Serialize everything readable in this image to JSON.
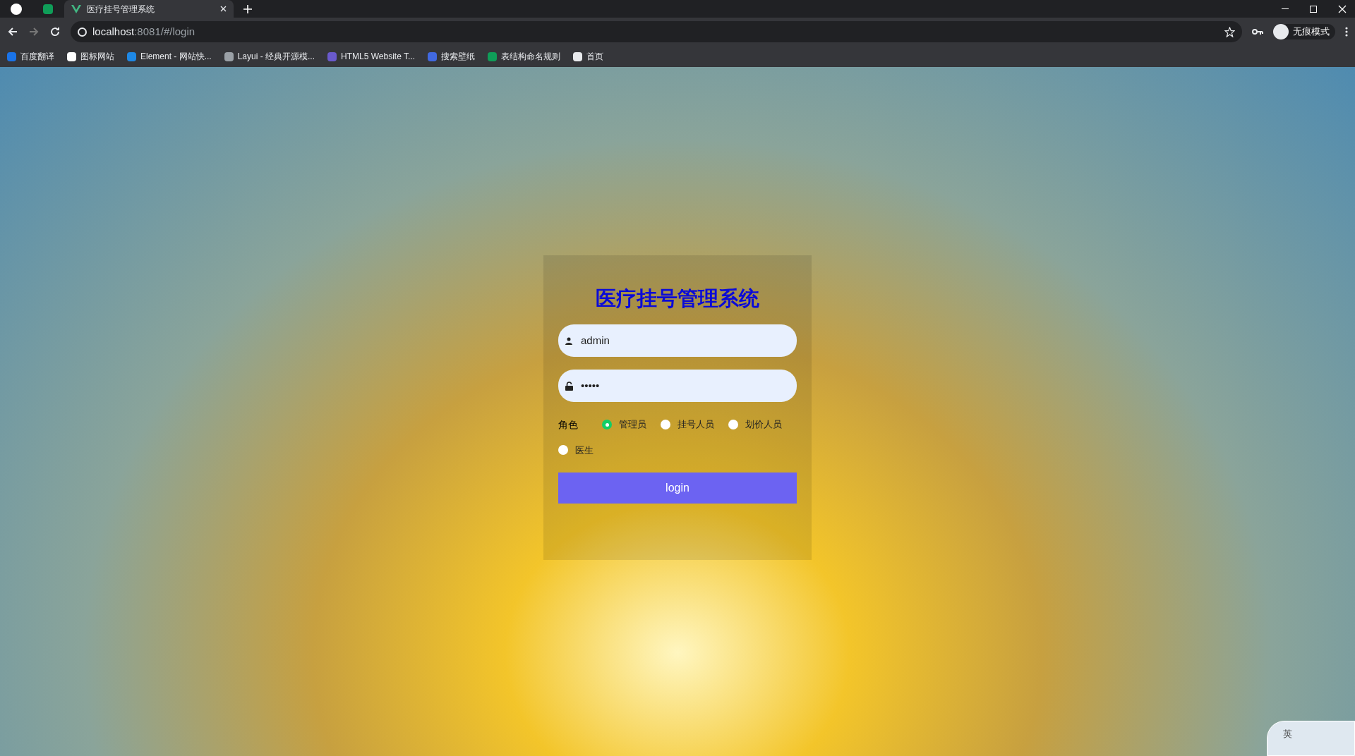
{
  "browser": {
    "tabs": [
      {
        "title": "医疗挂号管理系统",
        "selected": true
      }
    ],
    "address": {
      "host": "localhost",
      "path": ":8081/#/login"
    },
    "profile_label": "无痕模式",
    "bookmarks": [
      {
        "label": "百度翻译"
      },
      {
        "label": "图标网站"
      },
      {
        "label": "Element - 网站快..."
      },
      {
        "label": "Layui - 经典开源模..."
      },
      {
        "label": "HTML5 Website T..."
      },
      {
        "label": "搜索壁纸"
      },
      {
        "label": "表结构命名规则"
      },
      {
        "label": "首页"
      }
    ]
  },
  "login": {
    "title": "医疗挂号管理系统",
    "username": {
      "value": "admin"
    },
    "password": {
      "value": "•••••"
    },
    "role_label": "角色",
    "roles": [
      {
        "label": "管理员",
        "selected": true
      },
      {
        "label": "挂号人员",
        "selected": false
      },
      {
        "label": "划价人员",
        "selected": false
      },
      {
        "label": "医生",
        "selected": false
      }
    ],
    "submit": "login"
  },
  "ime": {
    "mode": "英"
  }
}
